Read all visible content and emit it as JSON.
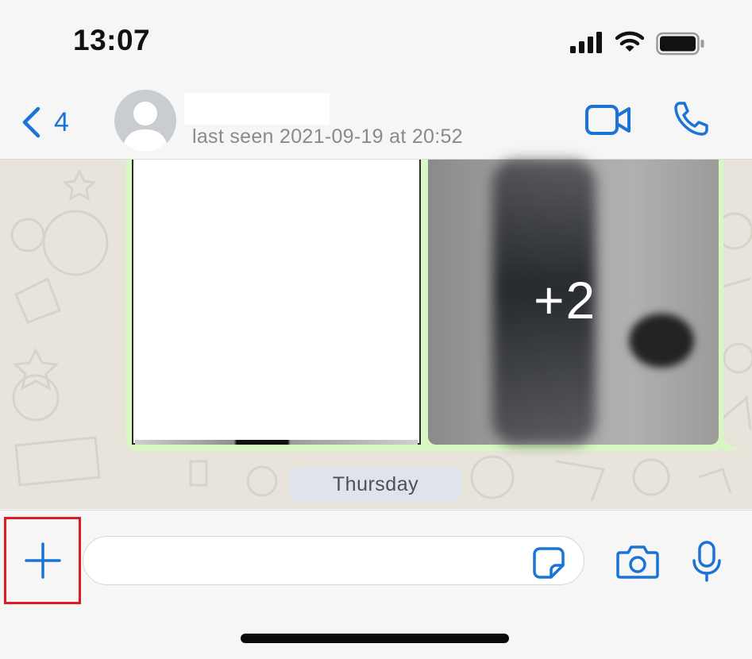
{
  "status_bar": {
    "time": "13:07",
    "icons": [
      "signal-icon",
      "wifi-icon",
      "battery-icon"
    ]
  },
  "header": {
    "back_count": "4",
    "last_seen": "last seen 2021-09-19 at 20:52",
    "icons": [
      "chevron-left-icon",
      "avatar-placeholder-icon",
      "video-call-icon",
      "phone-call-icon"
    ]
  },
  "chat": {
    "media_grid": {
      "more_count": "+2"
    },
    "day_separator": "Thursday"
  },
  "input_bar": {
    "message_placeholder": "",
    "icons": [
      "plus-icon",
      "sticker-icon",
      "camera-icon",
      "microphone-icon"
    ]
  },
  "colors": {
    "accent": "#1a73d6",
    "bubble_outgoing": "#d9f7c3",
    "highlight_box": "#e11b22",
    "chat_background": "#e8e4dc"
  }
}
